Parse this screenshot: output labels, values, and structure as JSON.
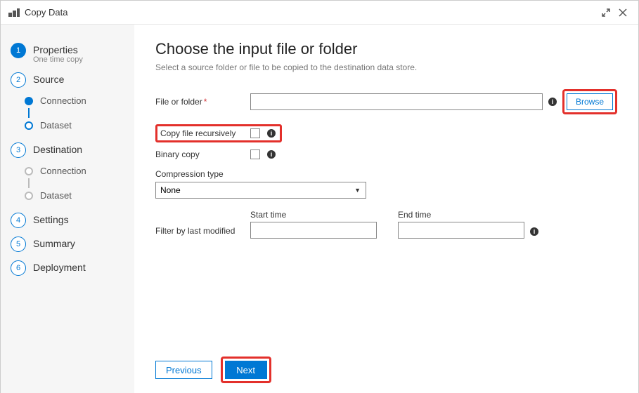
{
  "window": {
    "title": "Copy Data"
  },
  "sidebar": {
    "steps": [
      {
        "num": "1",
        "title": "Properties",
        "subtitle": "One time copy"
      },
      {
        "num": "2",
        "title": "Source"
      },
      {
        "num": "3",
        "title": "Destination"
      },
      {
        "num": "4",
        "title": "Settings"
      },
      {
        "num": "5",
        "title": "Summary"
      },
      {
        "num": "6",
        "title": "Deployment"
      }
    ],
    "source_sub": {
      "connection": "Connection",
      "dataset": "Dataset"
    },
    "dest_sub": {
      "connection": "Connection",
      "dataset": "Dataset"
    }
  },
  "main": {
    "heading": "Choose the input file or folder",
    "subheading": "Select a source folder or file to be copied to the destination data store.",
    "labels": {
      "file_or_folder": "File or folder",
      "copy_recursively": "Copy file recursively",
      "binary_copy": "Binary copy",
      "compression_type": "Compression type",
      "filter_last_modified": "Filter by last modified",
      "start_time": "Start time",
      "end_time": "End time"
    },
    "values": {
      "file_or_folder": "",
      "compression_type": "None",
      "start_time": "",
      "end_time": ""
    },
    "buttons": {
      "browse": "Browse",
      "previous": "Previous",
      "next": "Next"
    }
  }
}
